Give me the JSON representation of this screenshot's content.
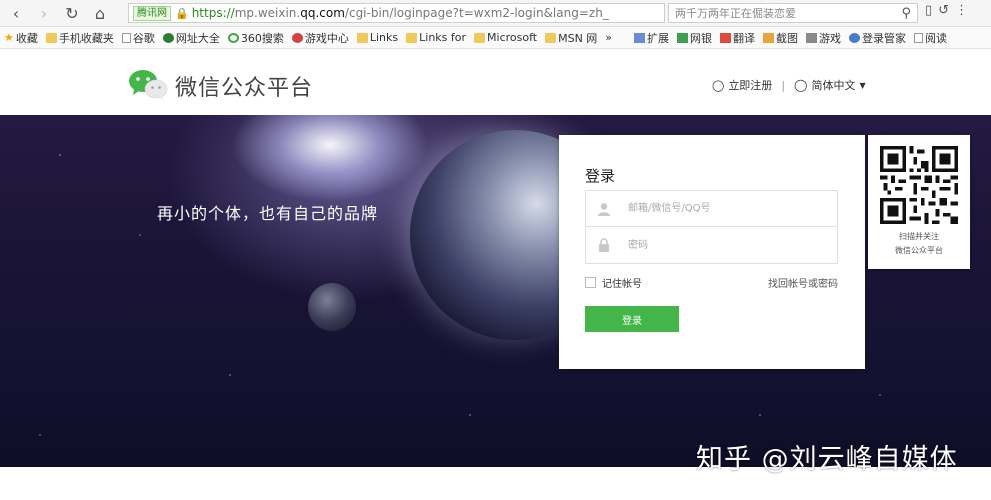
{
  "browser": {
    "site_tag": "腾讯网",
    "url_scheme": "https://",
    "url_host_pre": "mp.weixin.",
    "url_host_domain": "qq.com",
    "url_path": "/cgi-bin/loginpage?t=wxm2-login&lang=zh_",
    "search_text": "两千万两年正在倔装恋爱"
  },
  "bookmarks": {
    "left": [
      {
        "label": "收藏",
        "icon": "star-icon"
      },
      {
        "label": "手机收藏夹",
        "icon": "folder-icon"
      },
      {
        "label": "谷歌",
        "icon": "doc-icon"
      },
      {
        "label": "网址大全",
        "icon": "globe-icon"
      },
      {
        "label": "360搜索",
        "icon": "search-circle-icon"
      },
      {
        "label": "游戏中心",
        "icon": "game-icon"
      },
      {
        "label": "Links",
        "icon": "folder-icon"
      },
      {
        "label": "Links for",
        "icon": "folder-icon"
      },
      {
        "label": "Microsoft",
        "icon": "folder-icon"
      },
      {
        "label": "MSN 网",
        "icon": "folder-icon"
      },
      {
        "label": "»",
        "icon": ""
      }
    ],
    "right": [
      {
        "label": "扩展"
      },
      {
        "label": "网银"
      },
      {
        "label": "翻译"
      },
      {
        "label": "截图"
      },
      {
        "label": "游戏"
      },
      {
        "label": "登录管家"
      },
      {
        "label": "阅读"
      }
    ]
  },
  "header": {
    "title": "微信公众平台",
    "register": "立即注册",
    "language": "简体中文"
  },
  "banner": {
    "slogan": "再小的个体，也有自己的品牌"
  },
  "login": {
    "title": "登录",
    "account_placeholder": "邮箱/微信号/QQ号",
    "password_placeholder": "密码",
    "remember": "记住帐号",
    "forgot": "找回帐号或密码",
    "submit": "登录"
  },
  "qr": {
    "line1": "扫描并关注",
    "line2": "微信公众平台"
  },
  "watermark": "知乎 @刘云峰自媒体",
  "colors": {
    "accent_green": "#44b549"
  }
}
